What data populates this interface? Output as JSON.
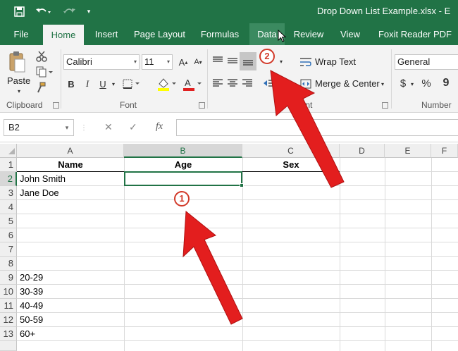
{
  "window": {
    "title": "Drop Down List Example.xlsx  -  E",
    "qat": {
      "save_icon": "save-icon",
      "undo_icon": "undo-icon",
      "redo_icon": "redo-icon",
      "customize_icon": "customize-qat-icon"
    }
  },
  "tabs": [
    {
      "label": "File"
    },
    {
      "label": "Home"
    },
    {
      "label": "Insert"
    },
    {
      "label": "Page Layout"
    },
    {
      "label": "Formulas"
    },
    {
      "label": "Data"
    },
    {
      "label": "Review"
    },
    {
      "label": "View"
    },
    {
      "label": "Foxit Reader PDF"
    }
  ],
  "ribbon": {
    "clipboard": {
      "paste_label": "Paste",
      "group_label": "Clipboard"
    },
    "font": {
      "font_name": "Calibri",
      "font_size": "11",
      "group_label": "Font",
      "bold": "B",
      "italic": "I",
      "underline": "U",
      "font_color_glyph": "A"
    },
    "alignment": {
      "wrap_text": "Wrap Text",
      "merge_center": "Merge & Center",
      "group_label": "nment"
    },
    "number": {
      "format": "General",
      "currency": "$",
      "percent": "%",
      "comma": "9",
      "group_label": "Number"
    }
  },
  "formula_bar": {
    "name_box": "B2",
    "cancel": "✕",
    "enter": "✓",
    "fx": "fx",
    "value": ""
  },
  "sheet": {
    "columns": [
      "A",
      "B",
      "C",
      "D",
      "E",
      "F"
    ],
    "rows": [
      "1",
      "2",
      "3",
      "4",
      "5",
      "6",
      "7",
      "8",
      "9",
      "10",
      "11",
      "12",
      "13"
    ],
    "headers": {
      "A1": "Name",
      "B1": "Age",
      "C1": "Sex"
    },
    "names": {
      "A2": "John Smith",
      "A3": "Jane Doe"
    },
    "age_ranges": [
      "20-29",
      "30-39",
      "40-49",
      "50-59",
      "60+"
    ],
    "selected_cell": "B2"
  },
  "callouts": {
    "one": "1",
    "two": "2"
  },
  "colors": {
    "excel_green": "#217346",
    "callout_red": "#d23a2a"
  }
}
